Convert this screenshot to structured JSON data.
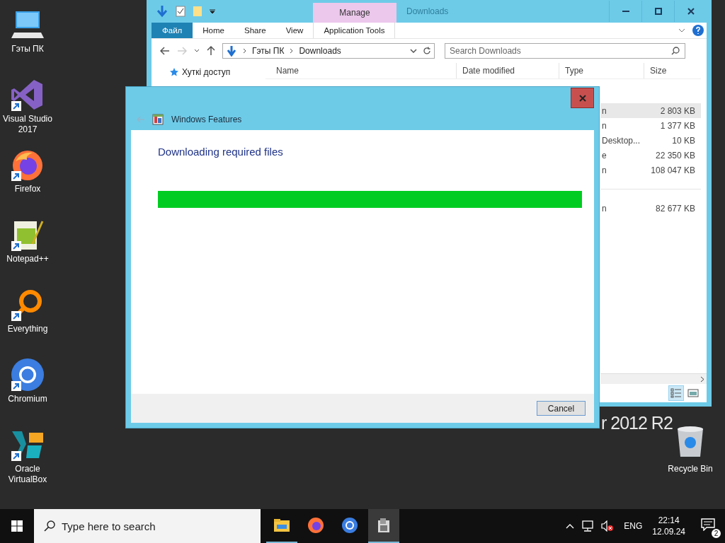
{
  "desktop": {
    "icons": [
      {
        "label": "Гэты ПК",
        "kind": "computer",
        "shortcut": false
      },
      {
        "label": "Visual Studio 2017",
        "kind": "vs",
        "shortcut": true
      },
      {
        "label": "Firefox",
        "kind": "firefox",
        "shortcut": true
      },
      {
        "label": "Notepad++",
        "kind": "notepad",
        "shortcut": true
      },
      {
        "label": "Everything",
        "kind": "everything",
        "shortcut": true
      },
      {
        "label": "Chromium",
        "kind": "chromium",
        "shortcut": true
      },
      {
        "label": "Oracle VirtualBox",
        "kind": "virtualbox",
        "shortcut": true
      }
    ],
    "recycle_bin": {
      "label": "Recycle Bin"
    },
    "branding": "r 2012 R2"
  },
  "explorer": {
    "title": "Downloads",
    "context_tab": "Manage",
    "ribbon_tabs": [
      {
        "label": "Файл",
        "kind": "file"
      },
      {
        "label": "Home",
        "kind": "tab"
      },
      {
        "label": "Share",
        "kind": "tab"
      },
      {
        "label": "View",
        "kind": "tab"
      },
      {
        "label": "Application Tools",
        "kind": "tab"
      }
    ],
    "path": [
      "Гэты ПК",
      "Downloads"
    ],
    "search": {
      "placeholder": "Search Downloads"
    },
    "columns": [
      "Name",
      "Date modified",
      "Type",
      "Size"
    ],
    "sidebar": {
      "items": [
        "Хуткі доступ"
      ]
    },
    "groups": [
      {
        "rows": [
          {
            "type": "n",
            "size": "2 803 KB",
            "selected": true
          },
          {
            "type": "n",
            "size": "1 377 KB",
            "selected": false
          },
          {
            "type": "Desktop...",
            "size": "10 KB",
            "selected": false
          },
          {
            "type": "e",
            "size": "22 350 KB",
            "selected": false
          },
          {
            "type": "n",
            "size": "108 047 KB",
            "selected": false
          }
        ]
      },
      {
        "rows": [
          {
            "type": "n",
            "size": "82 677 KB",
            "selected": false
          }
        ]
      }
    ]
  },
  "dialog": {
    "title": "Windows Features",
    "heading": "Downloading required files",
    "progress": {
      "level": 1.0
    },
    "buttons": [
      "Cancel"
    ]
  },
  "taskbar": {
    "search": {
      "placeholder": "Type here to search"
    },
    "apps": [
      {
        "kind": "explorer",
        "active": false,
        "running": true
      },
      {
        "kind": "firefox",
        "active": false,
        "running": false
      },
      {
        "kind": "chromium",
        "active": false,
        "running": false
      },
      {
        "kind": "features",
        "active": true,
        "running": true
      }
    ],
    "language": "ENG",
    "time": "22:14",
    "date": "12.09.24",
    "notifications": "2"
  }
}
